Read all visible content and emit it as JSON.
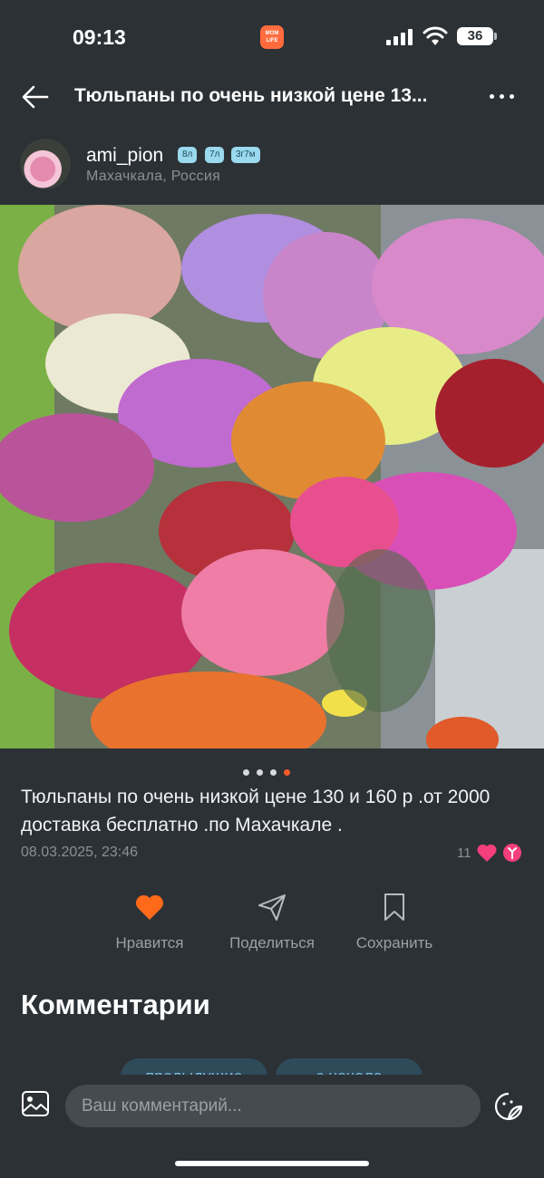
{
  "status_bar": {
    "time": "09:13",
    "app_badge": "MOM LIFE",
    "battery": "36"
  },
  "header": {
    "title": "Тюльпаны по очень низкой цене 13..."
  },
  "author": {
    "username": "ami_pion",
    "badges": [
      "8л",
      "7л",
      "3г7м"
    ],
    "location": "Махачкала, Россия"
  },
  "post": {
    "carousel_pages": 4,
    "carousel_active": 4,
    "caption": "Тюльпаны по очень низкой цене 130 и 160 р .от 2000 доставка бесплатно .по Махачкале .",
    "date": "08.03.2025, 23:46",
    "reactions_count": "11"
  },
  "actions": {
    "like_label": "Нравится",
    "share_label": "Поделиться",
    "save_label": "Сохранить"
  },
  "comments": {
    "title": "Комментарии",
    "prev_label": "предыдущие",
    "first_label": "с начала",
    "input_placeholder": "Ваш комментарий..."
  },
  "colors": {
    "background": "#2c3136",
    "accent": "#ff5b2a",
    "link": "#79b8d8"
  }
}
